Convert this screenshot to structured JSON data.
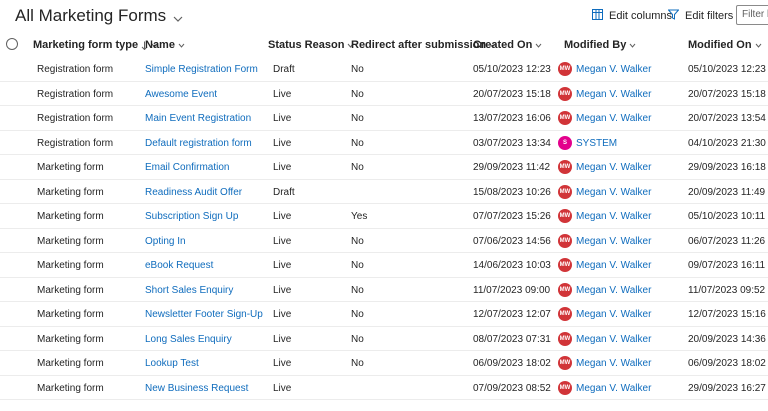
{
  "view": {
    "title": "All Marketing Forms"
  },
  "commands": {
    "edit_columns": "Edit columns",
    "edit_filters": "Edit filters",
    "filter_placeholder": "Filter by keyword"
  },
  "columns": {
    "type": "Marketing form type",
    "name": "Name",
    "status": "Status Reason",
    "redirect": "Redirect after submission",
    "created": "Created On",
    "modified_by": "Modified By",
    "modified_on": "Modified On"
  },
  "colors": {
    "link": "#0f6cbd",
    "avatar_mw": "#d13438",
    "avatar_system": "#e3008c"
  },
  "rows": [
    {
      "type": "Registration form",
      "name": "Simple Registration Form",
      "status": "Draft",
      "redirect": "No",
      "created": "05/10/2023 12:23",
      "initials": "MW",
      "modified_by": "Megan V. Walker",
      "modified_on": "05/10/2023 12:23"
    },
    {
      "type": "Registration form",
      "name": "Awesome Event",
      "status": "Live",
      "redirect": "No",
      "created": "20/07/2023 15:18",
      "initials": "MW",
      "modified_by": "Megan V. Walker",
      "modified_on": "20/07/2023 15:18"
    },
    {
      "type": "Registration form",
      "name": "Main Event Registration",
      "status": "Live",
      "redirect": "No",
      "created": "13/07/2023 16:06",
      "initials": "MW",
      "modified_by": "Megan V. Walker",
      "modified_on": "20/07/2023 13:54"
    },
    {
      "type": "Registration form",
      "name": "Default registration form",
      "status": "Live",
      "redirect": "No",
      "created": "03/07/2023 13:34",
      "initials": "S",
      "modified_by": "SYSTEM",
      "modified_on": "04/10/2023 21:30"
    },
    {
      "type": "Marketing form",
      "name": "Email Confirmation",
      "status": "Live",
      "redirect": "No",
      "created": "29/09/2023 11:42",
      "initials": "MW",
      "modified_by": "Megan V. Walker",
      "modified_on": "29/09/2023 16:18"
    },
    {
      "type": "Marketing form",
      "name": "Readiness Audit Offer",
      "status": "Draft",
      "redirect": "",
      "created": "15/08/2023 10:26",
      "initials": "MW",
      "modified_by": "Megan V. Walker",
      "modified_on": "20/09/2023 11:49"
    },
    {
      "type": "Marketing form",
      "name": "Subscription Sign Up",
      "status": "Live",
      "redirect": "Yes",
      "created": "07/07/2023 15:26",
      "initials": "MW",
      "modified_by": "Megan V. Walker",
      "modified_on": "05/10/2023 10:11"
    },
    {
      "type": "Marketing form",
      "name": "Opting In",
      "status": "Live",
      "redirect": "No",
      "created": "07/06/2023 14:56",
      "initials": "MW",
      "modified_by": "Megan V. Walker",
      "modified_on": "06/07/2023 11:26"
    },
    {
      "type": "Marketing form",
      "name": "eBook Request",
      "status": "Live",
      "redirect": "No",
      "created": "14/06/2023 10:03",
      "initials": "MW",
      "modified_by": "Megan V. Walker",
      "modified_on": "09/07/2023 16:11"
    },
    {
      "type": "Marketing form",
      "name": "Short Sales Enquiry",
      "status": "Live",
      "redirect": "No",
      "created": "11/07/2023 09:00",
      "initials": "MW",
      "modified_by": "Megan V. Walker",
      "modified_on": "11/07/2023 09:52"
    },
    {
      "type": "Marketing form",
      "name": "Newsletter Footer Sign-Up",
      "status": "Live",
      "redirect": "No",
      "created": "12/07/2023 12:07",
      "initials": "MW",
      "modified_by": "Megan V. Walker",
      "modified_on": "12/07/2023 15:16"
    },
    {
      "type": "Marketing form",
      "name": "Long Sales Enquiry",
      "status": "Live",
      "redirect": "No",
      "created": "08/07/2023 07:31",
      "initials": "MW",
      "modified_by": "Megan V. Walker",
      "modified_on": "20/09/2023 14:36"
    },
    {
      "type": "Marketing form",
      "name": "Lookup Test",
      "status": "Live",
      "redirect": "No",
      "created": "06/09/2023 18:02",
      "initials": "MW",
      "modified_by": "Megan V. Walker",
      "modified_on": "06/09/2023 18:02"
    },
    {
      "type": "Marketing form",
      "name": "New Business Request",
      "status": "Live",
      "redirect": "",
      "created": "07/09/2023 08:52",
      "initials": "MW",
      "modified_by": "Megan V. Walker",
      "modified_on": "29/09/2023 16:27"
    }
  ]
}
